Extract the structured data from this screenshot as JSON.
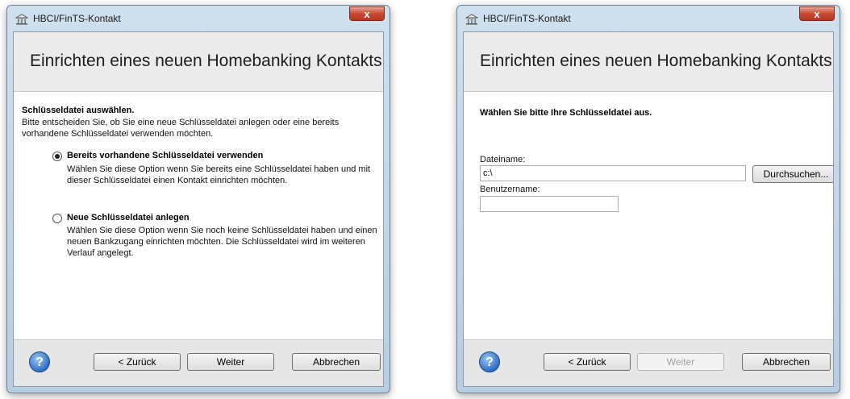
{
  "window1": {
    "title": "HBCI/FinTS-Kontakt",
    "close_label": "x",
    "header_title": "Einrichten eines neuen Homebanking Kontakts",
    "section_title": "Schlüsseldatei auswählen.",
    "section_desc": "Bitte entscheiden Sie, ob Sie eine neue Schlüsseldatei anlegen oder eine bereits vorhandene Schlüsseldatei verwenden möchten.",
    "options": [
      {
        "label": "Bereits vorhandene Schlüsseldatei verwenden",
        "desc": "Wählen Sie diese Option wenn Sie bereits eine Schlüsseldatei haben und mit dieser Schlüsseldatei einen Kontakt einrichten möchten.",
        "checked": true
      },
      {
        "label": "Neue Schlüsseldatei anlegen",
        "desc": "Wählen Sie diese Option wenn Sie noch keine Schlüsseldatei haben und einen neuen Bankzugang einrichten möchten. Die Schlüsseldatei wird im weiteren Verlauf angelegt.",
        "checked": false
      }
    ],
    "footer": {
      "back_label": "< Zurück",
      "next_label": "Weiter",
      "cancel_label": "Abbrechen",
      "help_icon": "?"
    }
  },
  "window2": {
    "title": "HBCI/FinTS-Kontakt",
    "close_label": "x",
    "header_title": "Einrichten eines neuen Homebanking Kontakts",
    "prompt": "Wählen Sie bitte Ihre Schlüsseldatei aus.",
    "filename_label": "Dateiname:",
    "filename_value": "c:\\",
    "browse_label": "Durchsuchen...",
    "username_label": "Benutzername:",
    "username_value": "",
    "footer": {
      "back_label": "< Zurück",
      "next_label": "Weiter",
      "cancel_label": "Abbrechen",
      "help_icon": "?"
    }
  },
  "icons": {
    "title_icon": "bank-icon",
    "help_icon": "help-icon",
    "close_icon": "close-icon"
  }
}
